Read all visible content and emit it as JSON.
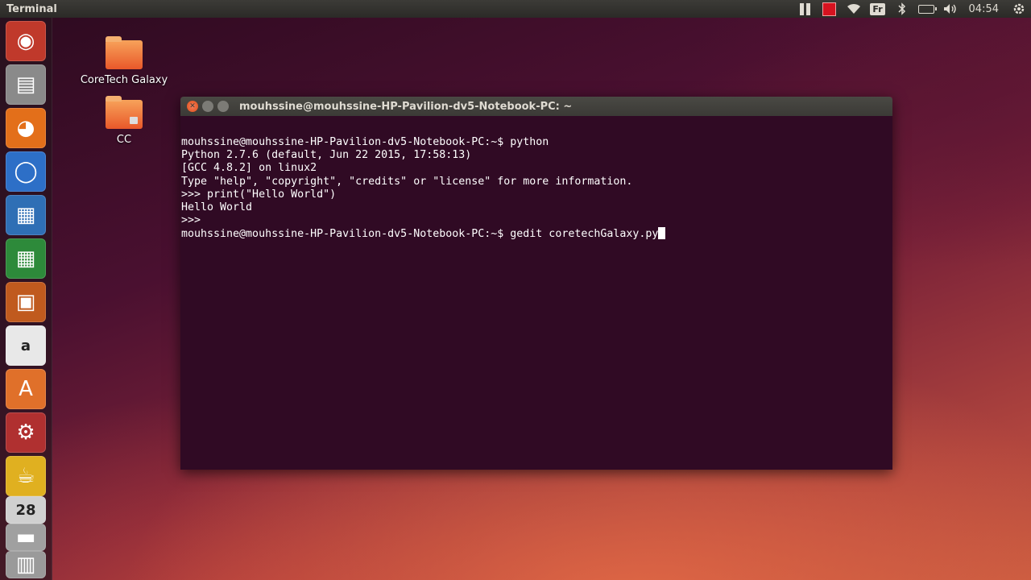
{
  "top_panel": {
    "app_title": "Terminal",
    "keyboard_layout": "Fr",
    "clock": "04:54",
    "indicators": [
      "pause-icon",
      "record-stop-icon",
      "wifi-icon",
      "keyboard-layout",
      "bluetooth-icon",
      "battery-icon",
      "volume-icon",
      "clock",
      "power-gear-icon"
    ]
  },
  "launcher": {
    "items": [
      {
        "name": "ubuntu-dash-icon",
        "glyph": "◉",
        "color": "#c0392b"
      },
      {
        "name": "files-icon",
        "glyph": "▤",
        "color": "#8a8a8a"
      },
      {
        "name": "firefox-icon",
        "glyph": "◕",
        "color": "#e36f1a"
      },
      {
        "name": "chromium-icon",
        "glyph": "◯",
        "color": "#2d6fc7"
      },
      {
        "name": "writer-icon",
        "glyph": "▦",
        "color": "#2f6fb5"
      },
      {
        "name": "calc-icon",
        "glyph": "▦",
        "color": "#2d8a3a"
      },
      {
        "name": "impress-icon",
        "glyph": "▣",
        "color": "#c05a1e"
      },
      {
        "name": "amazon-icon",
        "glyph": "a",
        "color": "#e8e8e8"
      },
      {
        "name": "software-center-icon",
        "glyph": "A",
        "color": "#e0702a"
      },
      {
        "name": "system-settings-icon",
        "glyph": "⚙",
        "color": "#b03030"
      },
      {
        "name": "teapot-icon",
        "glyph": "☕",
        "color": "#e0b020"
      },
      {
        "name": "calendar-icon",
        "glyph": "28",
        "color": "#d0d0d0"
      },
      {
        "name": "scanner-icon",
        "glyph": "▬",
        "color": "#a0a0a0"
      },
      {
        "name": "trash-icon",
        "glyph": "▥",
        "color": "#9a9a9a"
      }
    ]
  },
  "desktop": {
    "icons": [
      {
        "label": "CoreTech Galaxy",
        "locked": false
      },
      {
        "label": "CC",
        "locked": true
      }
    ]
  },
  "terminal": {
    "title": "mouhssine@mouhssine-HP-Pavilion-dv5-Notebook-PC: ~",
    "lines": [
      "mouhssine@mouhssine-HP-Pavilion-dv5-Notebook-PC:~$ python",
      "Python 2.7.6 (default, Jun 22 2015, 17:58:13)",
      "[GCC 4.8.2] on linux2",
      "Type \"help\", \"copyright\", \"credits\" or \"license\" for more information.",
      ">>> print(\"Hello World\")",
      "Hello World",
      ">>> ",
      "mouhssine@mouhssine-HP-Pavilion-dv5-Notebook-PC:~$ gedit coretechGalaxy.py"
    ],
    "background": "#300a24",
    "foreground": "#ffffff"
  }
}
